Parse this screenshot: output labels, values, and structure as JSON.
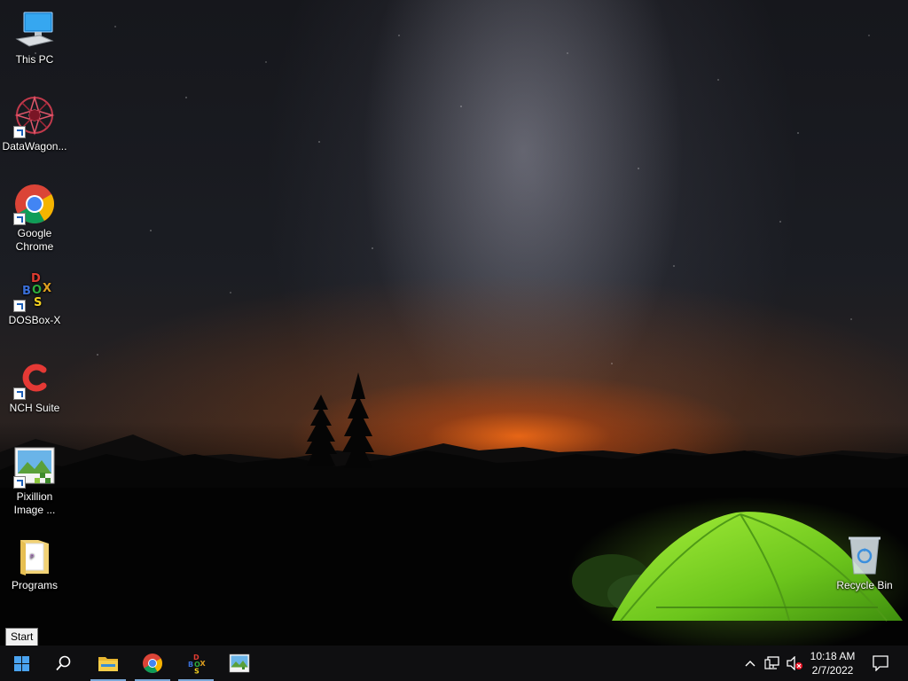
{
  "desktop": {
    "icons": [
      {
        "label": "This PC"
      },
      {
        "label": "DataWagon..."
      },
      {
        "label": "Google Chrome"
      },
      {
        "label": "DOSBox-X"
      },
      {
        "label": "NCH Suite"
      },
      {
        "label": "Pixillion Image ..."
      },
      {
        "label": "Programs"
      },
      {
        "label": "Recycle Bin"
      }
    ]
  },
  "tooltip": {
    "text": "Start"
  },
  "taskbar": {
    "buttons": [
      {
        "name": "start",
        "icon": "windows-logo-icon"
      },
      {
        "name": "search",
        "icon": "search-icon"
      },
      {
        "name": "file-explorer",
        "icon": "folder-icon"
      },
      {
        "name": "chrome",
        "icon": "chrome-icon"
      },
      {
        "name": "dosbox-x",
        "icon": "dosbox-icon"
      },
      {
        "name": "pixillion",
        "icon": "pixillion-icon"
      }
    ],
    "tray": {
      "time": "10:18 AM",
      "date": "2/7/2022"
    }
  },
  "colors": {
    "taskbar": "#101012",
    "accent": "#0078d7",
    "tent": "#7ed321",
    "horizon_glow": "#ff6e14"
  }
}
